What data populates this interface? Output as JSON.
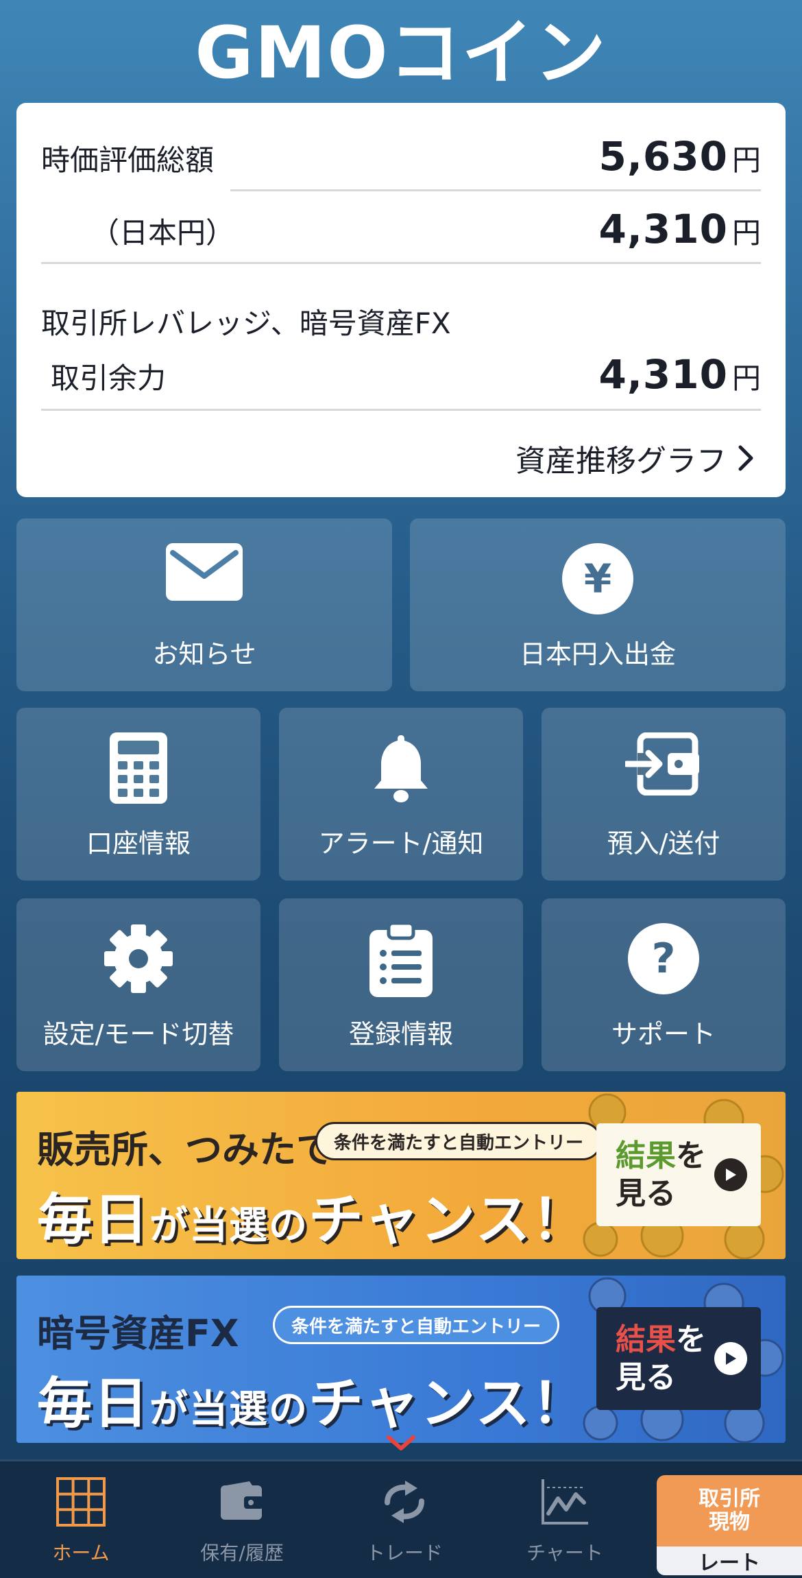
{
  "header": {
    "logo": "GMOコイン"
  },
  "summary": {
    "total_label": "時価評価総額",
    "total_value": "5,630",
    "jpy_label": "（日本円）",
    "jpy_value": "4,310",
    "fx_title": "取引所レバレッジ、暗号資産FX",
    "margin_label": "取引余力",
    "margin_value": "4,310",
    "currency": "円",
    "graph_link": "資産推移グラフ"
  },
  "tiles": [
    {
      "label": "お知らせ",
      "icon": "envelope-icon"
    },
    {
      "label": "日本円入出金",
      "icon": "yen-icon"
    },
    {
      "label": "口座情報",
      "icon": "calculator-icon"
    },
    {
      "label": "アラート/通知",
      "icon": "bell-icon"
    },
    {
      "label": "預入/送付",
      "icon": "wallet-transfer-icon"
    },
    {
      "label": "設定/モード切替",
      "icon": "gear-icon"
    },
    {
      "label": "登録情報",
      "icon": "clipboard-icon"
    },
    {
      "label": "サポート",
      "icon": "question-icon"
    }
  ],
  "banners": [
    {
      "title": "販売所、つみたて",
      "pill": "条件を満たすと自動エントリー",
      "main_big": "毎日",
      "main_small1": "が当選",
      "main_small2": "の",
      "main_end": "チャンス！",
      "cta_accent": "結果",
      "cta_rest": "を",
      "cta_line2": "見る",
      "colors": {
        "accent": "#5a9a2e"
      }
    },
    {
      "title": "暗号資産FX",
      "pill": "条件を満たすと自動エントリー",
      "main_big": "毎日",
      "main_small1": "が当選",
      "main_small2": "の",
      "main_end": "チャンス！",
      "cta_accent": "結果",
      "cta_rest": "を",
      "cta_line2": "見る",
      "colors": {
        "accent": "#e8504a"
      }
    }
  ],
  "nav": {
    "items": [
      {
        "label": "ホーム",
        "icon": "grid-icon",
        "active": true
      },
      {
        "label": "保有/履歴",
        "icon": "wallet-icon",
        "active": false
      },
      {
        "label": "トレード",
        "icon": "exchange-icon",
        "active": false
      },
      {
        "label": "チャート",
        "icon": "chart-icon",
        "active": false
      }
    ],
    "rate": {
      "line1": "取引所",
      "line2": "現物",
      "line3": "レート"
    }
  },
  "colors": {
    "nav_active": "#f29a4a",
    "rate_button": "#f19a55",
    "background_top": "#3f86b6",
    "background_bottom": "#173d60"
  }
}
